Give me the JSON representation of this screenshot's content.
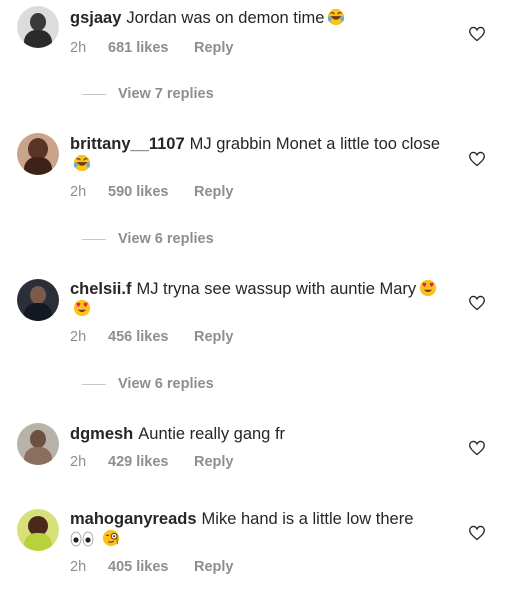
{
  "comments": [
    {
      "username": "gsjaay",
      "text": "Jordan was on demon time",
      "emoji": [
        "laugh"
      ],
      "time": "2h",
      "likes": "681 likes",
      "reply": "Reply",
      "view_replies": "View 7 replies"
    },
    {
      "username": "brittany__1107",
      "text": "MJ grabbin Monet a little too close",
      "emoji": [
        "laugh"
      ],
      "time": "2h",
      "likes": "590 likes",
      "reply": "Reply",
      "view_replies": "View 6 replies"
    },
    {
      "username": "chelsii.f",
      "text": "MJ tryna see wassup with auntie Mary",
      "emoji": [
        "heart-eyes",
        "heart-eyes"
      ],
      "time": "2h",
      "likes": "456 likes",
      "reply": "Reply",
      "view_replies": "View 6 replies"
    },
    {
      "username": "dgmesh",
      "text": "Auntie really gang fr",
      "emoji": [],
      "time": "2h",
      "likes": "429 likes",
      "reply": "Reply"
    },
    {
      "username": "mahoganyreads",
      "text": "Mike hand is a little low there",
      "emoji": [
        "eyes",
        "monocle"
      ],
      "time": "2h",
      "likes": "405 likes",
      "reply": "Reply"
    }
  ],
  "icons": {
    "like": "heart-outline-icon"
  },
  "colors": {
    "text": "#262626",
    "secondary": "#8e8e8e",
    "divider": "#c7c7c7"
  }
}
